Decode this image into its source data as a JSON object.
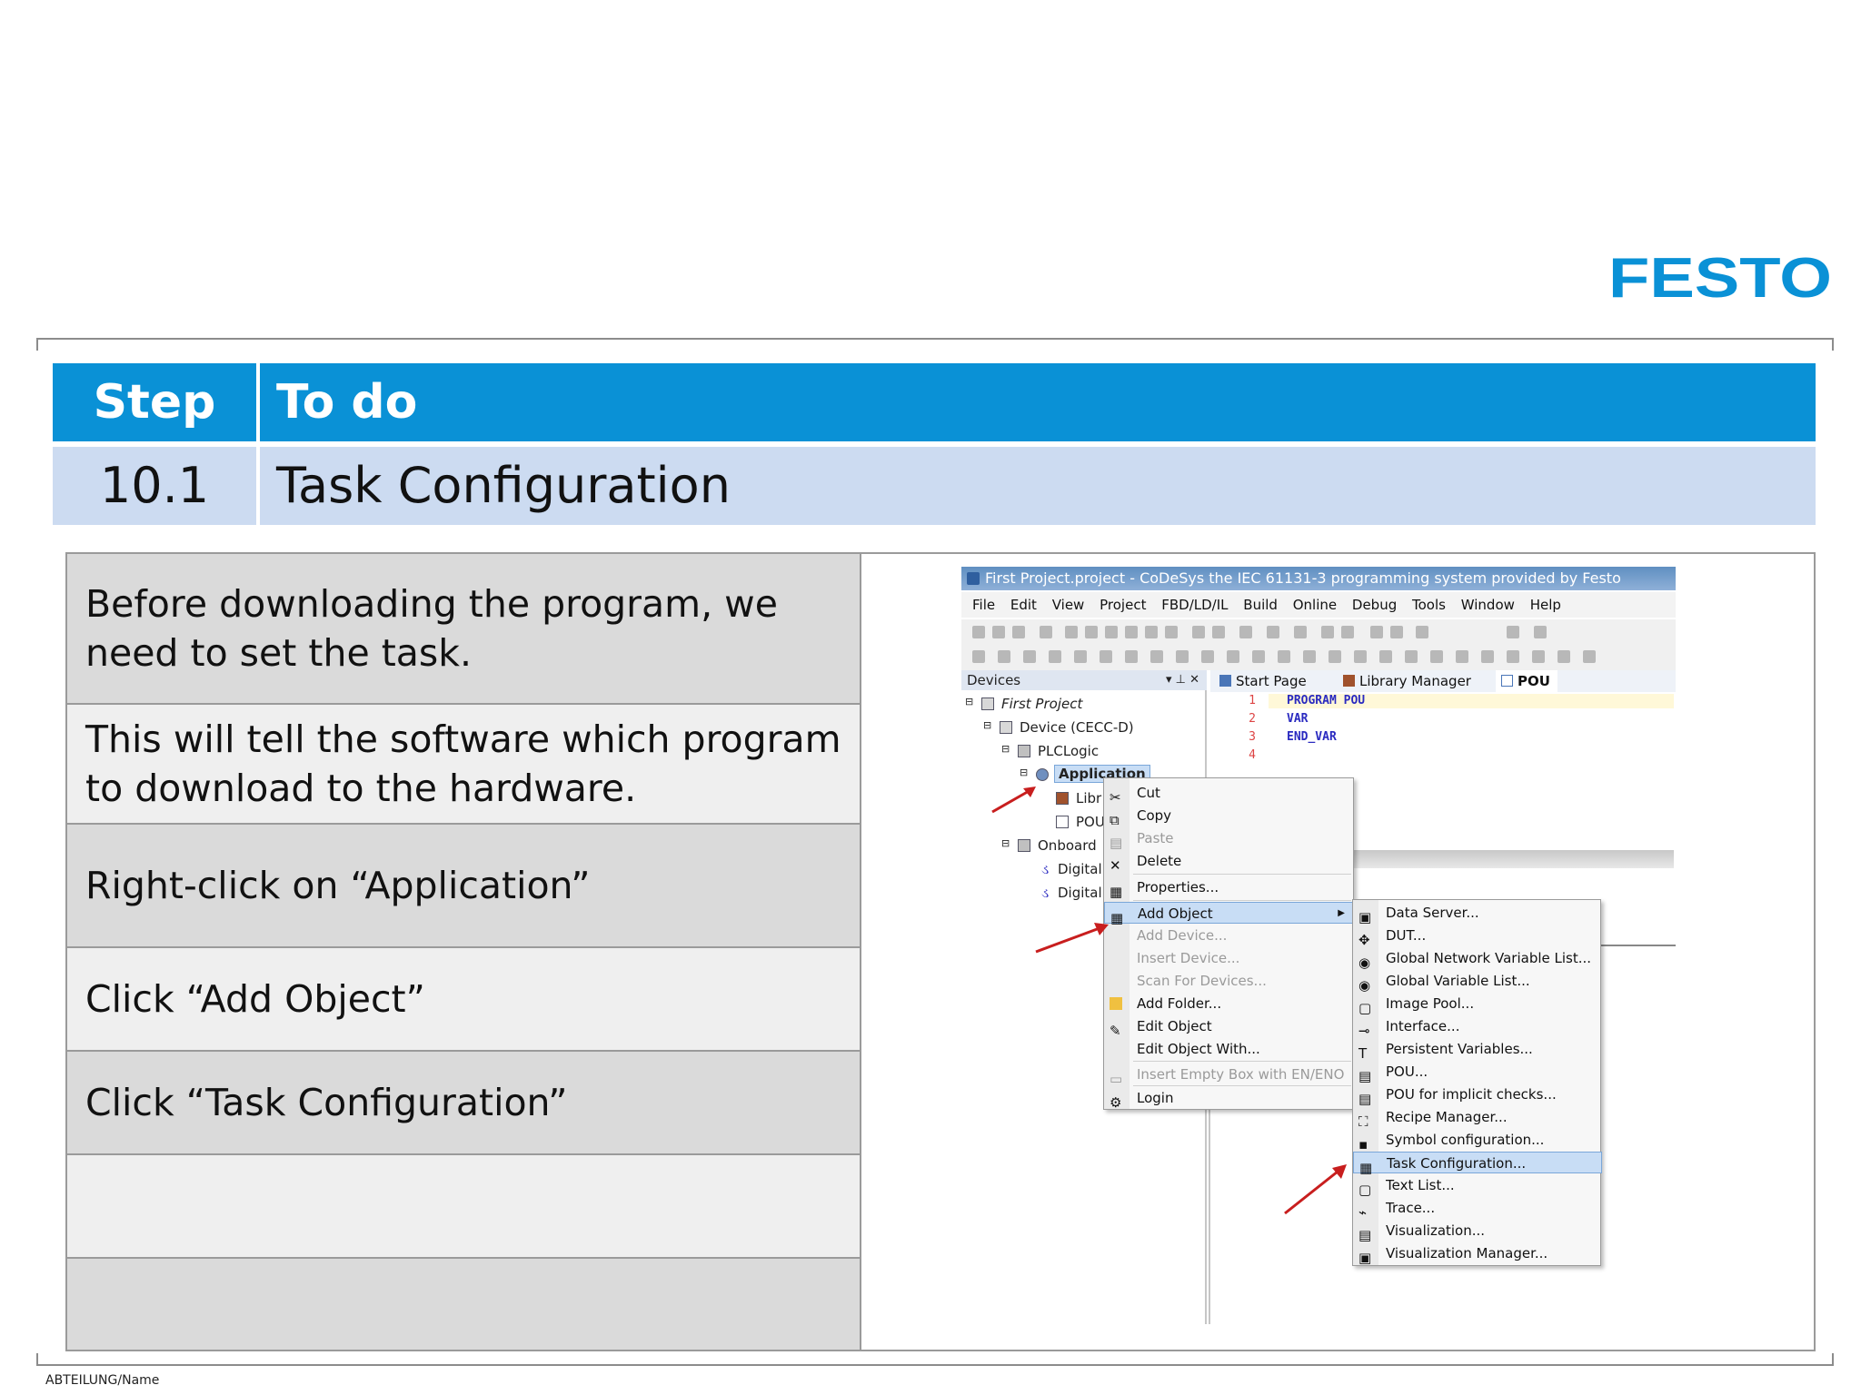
{
  "brand": {
    "logo_text": "FESTO",
    "color": "#0a91d6"
  },
  "header": {
    "col_step": "Step",
    "col_todo": "To do"
  },
  "current_step": {
    "number": "10.1",
    "title": "Task Configuration"
  },
  "instructions": [
    "Before downloading the program, we need to set the task.",
    "This will tell the software which program to download to the hardware.",
    "Right-click on “Application”",
    "Click “Add Object”",
    "Click “Task Configuration”",
    "",
    ""
  ],
  "footer": "ABTEILUNG/Name",
  "screenshot": {
    "title": "First Project.project - CoDeSys the IEC 61131-3 programming system provided by Festo",
    "menu": [
      "File",
      "Edit",
      "View",
      "Project",
      "FBD/LD/IL",
      "Build",
      "Online",
      "Debug",
      "Tools",
      "Window",
      "Help"
    ],
    "devices_panel": {
      "title": "Devices",
      "tree": [
        "First Project",
        "Device (CECC-D)",
        "PLCLogic",
        "Application",
        "Libr",
        "POU",
        "Onboard",
        "Digital",
        "Digital"
      ]
    },
    "tabs": [
      "Start Page",
      "Library Manager",
      "POU"
    ],
    "code": [
      {
        "line": "1",
        "text": "PROGRAM POU"
      },
      {
        "line": "2",
        "text": "VAR"
      },
      {
        "line": "3",
        "text": "END_VAR"
      },
      {
        "line": "4",
        "text": ""
      }
    ],
    "context_menu": [
      {
        "label": "Cut",
        "disabled": false
      },
      {
        "label": "Copy",
        "disabled": false
      },
      {
        "label": "Paste",
        "disabled": true
      },
      {
        "label": "Delete",
        "disabled": false
      },
      {
        "label": "Properties...",
        "disabled": false
      },
      {
        "label": "Add Object",
        "disabled": false,
        "selected": true
      },
      {
        "label": "Add Device...",
        "disabled": true
      },
      {
        "label": "Insert Device...",
        "disabled": true
      },
      {
        "label": "Scan For Devices...",
        "disabled": true
      },
      {
        "label": "Add Folder...",
        "disabled": false
      },
      {
        "label": "Edit Object",
        "disabled": false
      },
      {
        "label": "Edit Object With...",
        "disabled": false
      },
      {
        "label": "Insert Empty Box with EN/ENO",
        "disabled": true
      },
      {
        "label": "Login",
        "disabled": false
      }
    ],
    "submenu": [
      "Data Server...",
      "DUT...",
      "Global Network Variable List...",
      "Global Variable List...",
      "Image Pool...",
      "Interface...",
      "Persistent Variables...",
      "POU...",
      "POU for implicit checks...",
      "Recipe Manager...",
      "Symbol configuration...",
      "Task Configuration...",
      "Text List...",
      "Trace...",
      "Visualization...",
      "Visualization Manager..."
    ],
    "submenu_selected": "Task Configuration..."
  }
}
